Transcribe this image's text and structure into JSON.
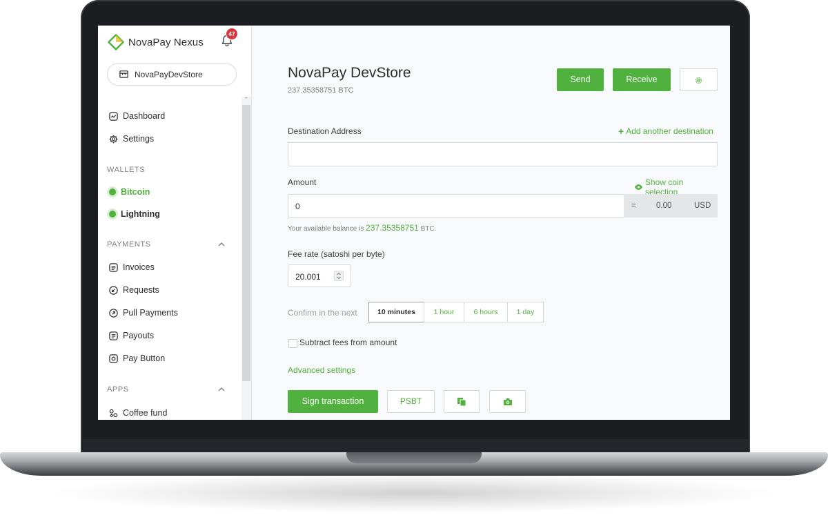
{
  "brand": {
    "name": "NovaPay Nexus",
    "notifications_count": "47"
  },
  "store_selector": {
    "label": "NovaPayDevStore"
  },
  "sidebar": {
    "nav": [
      {
        "label": "Dashboard",
        "icon": "dashboard-icon"
      },
      {
        "label": "Settings",
        "icon": "gear-icon"
      }
    ],
    "wallets_heading": "WALLETS",
    "wallets": [
      {
        "label": "Bitcoin",
        "active": true
      },
      {
        "label": "Lightning",
        "active": false
      }
    ],
    "payments_heading": "PAYMENTS",
    "payments": [
      {
        "label": "Invoices",
        "icon": "invoice-icon"
      },
      {
        "label": "Requests",
        "icon": "request-icon"
      },
      {
        "label": "Pull Payments",
        "icon": "pull-payment-icon"
      },
      {
        "label": "Payouts",
        "icon": "payout-icon"
      },
      {
        "label": "Pay Button",
        "icon": "pay-button-icon"
      }
    ],
    "apps_heading": "APPS",
    "apps": [
      {
        "label": "Coffee fund",
        "icon": "app-icon"
      }
    ]
  },
  "header": {
    "title": "NovaPay DevStore",
    "balance": "237.35358751 BTC",
    "send_label": "Send",
    "receive_label": "Receive"
  },
  "form": {
    "destination_label": "Destination Address",
    "add_destination_label": "Add another destination",
    "amount_label": "Amount",
    "show_coin_selection_label": "Show coin selection",
    "amount_value": "0",
    "fiat_equals": "=",
    "fiat_value": "0.00",
    "fiat_currency": "USD",
    "available_prefix": "Your available balance is",
    "available_amount": "237.35358751",
    "available_suffix": "BTC.",
    "fee_rate_label": "Fee rate (satoshi per byte)",
    "fee_rate_value": "20.001",
    "confirm_label": "Confirm in the next",
    "confirm_options": [
      "10 minutes",
      "1 hour",
      "6 hours",
      "1 day"
    ],
    "confirm_selected": "10 minutes",
    "subtract_fees_label": "Subtract fees from amount",
    "advanced_settings_label": "Advanced settings",
    "sign_label": "Sign transaction",
    "psbt_label": "PSBT"
  },
  "colors": {
    "accent": "#51b13e",
    "badge": "#d9363e",
    "text": "#2b2f33"
  }
}
